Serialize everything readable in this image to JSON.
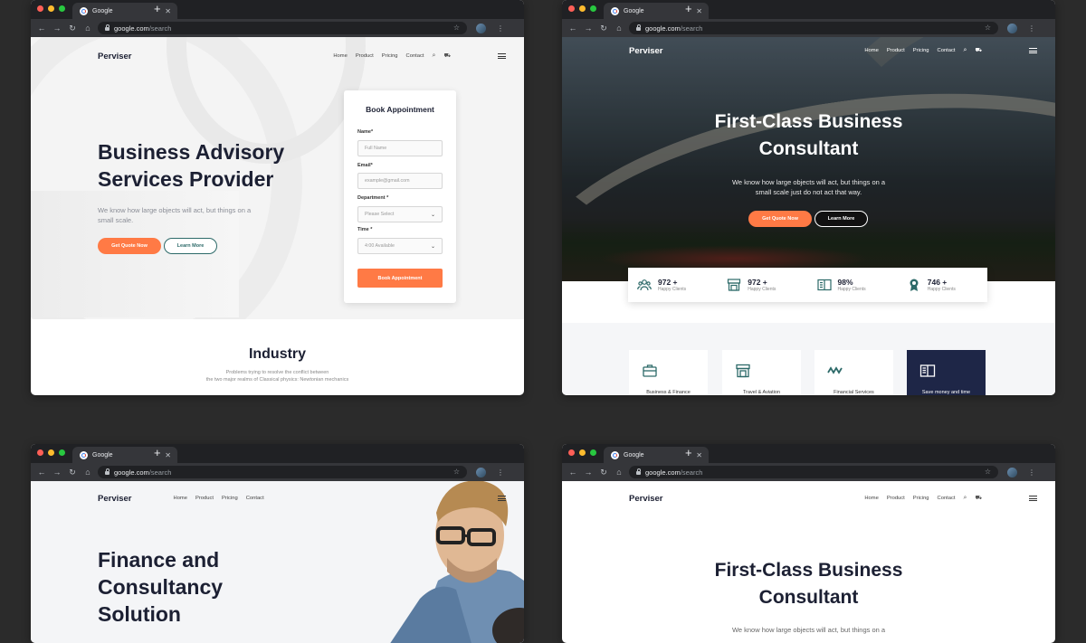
{
  "browser": {
    "tab_title": "Google",
    "tab_close": "✕",
    "new_tab": "+",
    "url_host": "google.com",
    "url_path": "/search",
    "back": "←",
    "forward": "→",
    "reload": "↻",
    "home": "⌂",
    "star": "☆",
    "menu": "⋮"
  },
  "site": {
    "logo": "Perviser",
    "nav": [
      "Home",
      "Product",
      "Pricing",
      "Contact"
    ],
    "search_icon": "⌕",
    "cart_icon": "🛒"
  },
  "w1": {
    "title_line1": "Business Advisory",
    "title_line2": "Services Provider",
    "desc_line1": "We know how large objects will act, but things on a",
    "desc_line2": "small scale.",
    "cta_primary": "Get Quote Now",
    "cta_secondary": "Learn More",
    "form": {
      "title": "Book Appointment",
      "name_label": "Name*",
      "name_placeholder": "Full Name",
      "email_label": "Email*",
      "email_placeholder": "example@gmail.com",
      "dept_label": "Department *",
      "dept_value": "Please Select",
      "time_label": "Time *",
      "time_value": "4:00 Available",
      "submit": "Book Appointment"
    },
    "section_title": "Industry",
    "section_sub1": "Problems trying to resolve the conflict between",
    "section_sub2": "the two major realms of Classical physics: Newtonian mechanics"
  },
  "w2": {
    "title_line1": "First-Class Business",
    "title_line2": "Consultant",
    "desc_line1": "We know how large objects will act, but things on a",
    "desc_line2": "small scale just do not act that way.",
    "cta_primary": "Get Quote Now",
    "cta_secondary": "Learn More",
    "stats": [
      {
        "value": "972 +",
        "label": "Happy Clients",
        "icon": "users-icon"
      },
      {
        "value": "972 +",
        "label": "Happy Clients",
        "icon": "store-icon"
      },
      {
        "value": "98%",
        "label": "Happy Clients",
        "icon": "newspaper-icon"
      },
      {
        "value": "746 +",
        "label": "Happy Clients",
        "icon": "award-icon"
      }
    ],
    "services": [
      {
        "label": "Business & Finance",
        "icon": "briefcase-icon"
      },
      {
        "label": "Travel & Aviation",
        "icon": "store-icon"
      },
      {
        "label": "Financial Services",
        "icon": "wave-icon"
      },
      {
        "label": "Save money and time",
        "icon": "book-icon"
      }
    ],
    "accent": "#2d6a69",
    "dark_card": "#1e2647"
  },
  "w3": {
    "title_line1": "Finance and",
    "title_line2": "Consultancy",
    "title_line3": "Solution"
  },
  "w4": {
    "title_line1": "First-Class Business",
    "title_line2": "Consultant",
    "desc_line1": "We know how large objects will act, but things on a"
  },
  "colors": {
    "orange": "#ff7a45",
    "navy": "#1c2033"
  }
}
